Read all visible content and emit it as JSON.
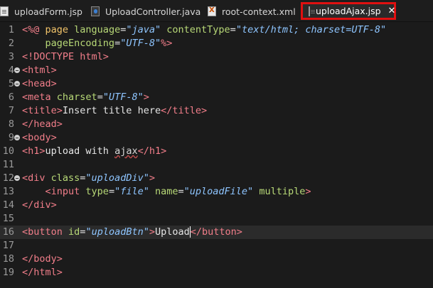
{
  "tabs": [
    {
      "label": "uploadForm.jsp",
      "icon": "document-icon",
      "active": false
    },
    {
      "label": "UploadController.java",
      "icon": "java-file-icon",
      "active": false
    },
    {
      "label": "root-context.xml",
      "icon": "xml-file-icon",
      "active": false
    },
    {
      "label": "uploadAjax.jsp",
      "icon": "document-icon",
      "active": true,
      "close": "✕"
    }
  ],
  "editor": {
    "lines": [
      {
        "num": "1",
        "fold": false,
        "tokens": [
          [
            "tg",
            "<%@ "
          ],
          [
            "kw",
            "page"
          ],
          [
            "tx",
            " "
          ],
          [
            "at",
            "language"
          ],
          [
            "tx",
            "="
          ],
          [
            "av",
            "\"java\""
          ],
          [
            "tx",
            " "
          ],
          [
            "at",
            "contentType"
          ],
          [
            "tx",
            "="
          ],
          [
            "av",
            "\"text/html; charset=UTF-8\""
          ]
        ]
      },
      {
        "num": "2",
        "fold": false,
        "tokens": [
          [
            "tx",
            "    "
          ],
          [
            "at",
            "pageEncoding"
          ],
          [
            "tx",
            "="
          ],
          [
            "av",
            "\"UTF-8\""
          ],
          [
            "tg",
            "%>"
          ]
        ]
      },
      {
        "num": "3",
        "fold": false,
        "tokens": [
          [
            "tg",
            "<!DOCTYPE html>"
          ]
        ]
      },
      {
        "num": "4",
        "fold": true,
        "tokens": [
          [
            "tg",
            "<html>"
          ]
        ]
      },
      {
        "num": "5",
        "fold": true,
        "tokens": [
          [
            "tg",
            "<head>"
          ]
        ]
      },
      {
        "num": "6",
        "fold": false,
        "tokens": [
          [
            "tg",
            "<meta "
          ],
          [
            "at",
            "charset"
          ],
          [
            "tx",
            "="
          ],
          [
            "av",
            "\"UTF-8\""
          ],
          [
            "tg",
            ">"
          ]
        ]
      },
      {
        "num": "7",
        "fold": false,
        "tokens": [
          [
            "tg",
            "<title>"
          ],
          [
            "tx",
            "Insert title here"
          ],
          [
            "tg",
            "</title>"
          ]
        ]
      },
      {
        "num": "8",
        "fold": false,
        "tokens": [
          [
            "tg",
            "</head>"
          ]
        ]
      },
      {
        "num": "9",
        "fold": true,
        "tokens": [
          [
            "tg",
            "<body>"
          ]
        ]
      },
      {
        "num": "10",
        "fold": false,
        "tokens": [
          [
            "tg",
            "<h1>"
          ],
          [
            "tx",
            "upload with "
          ],
          [
            "squig",
            "ajax"
          ],
          [
            "tg",
            "</h1>"
          ]
        ]
      },
      {
        "num": "11",
        "fold": false,
        "tokens": []
      },
      {
        "num": "12",
        "fold": true,
        "tokens": [
          [
            "tg",
            "<div "
          ],
          [
            "at",
            "class"
          ],
          [
            "tx",
            "="
          ],
          [
            "av",
            "\"uploadDiv\""
          ],
          [
            "tg",
            ">"
          ]
        ]
      },
      {
        "num": "13",
        "fold": false,
        "tokens": [
          [
            "tx",
            "    "
          ],
          [
            "tg",
            "<input "
          ],
          [
            "at",
            "type"
          ],
          [
            "tx",
            "="
          ],
          [
            "av",
            "\"file\""
          ],
          [
            "tx",
            " "
          ],
          [
            "at",
            "name"
          ],
          [
            "tx",
            "="
          ],
          [
            "av",
            "\"uploadFile\""
          ],
          [
            "tx",
            " "
          ],
          [
            "at",
            "multiple"
          ],
          [
            "tg",
            ">"
          ]
        ]
      },
      {
        "num": "14",
        "fold": false,
        "tokens": [
          [
            "tg",
            "</div>"
          ]
        ]
      },
      {
        "num": "15",
        "fold": false,
        "tokens": []
      },
      {
        "num": "16",
        "fold": false,
        "current": true,
        "tokens": [
          [
            "tg",
            "<button "
          ],
          [
            "at",
            "id"
          ],
          [
            "tx",
            "="
          ],
          [
            "av",
            "\"uploadBtn\""
          ],
          [
            "tg",
            ">"
          ],
          [
            "tx",
            "Upload"
          ],
          [
            "caret",
            ""
          ],
          [
            "tg",
            "</button>"
          ]
        ]
      },
      {
        "num": "17",
        "fold": false,
        "tokens": []
      },
      {
        "num": "18",
        "fold": false,
        "tokens": [
          [
            "tg",
            "</body>"
          ]
        ]
      },
      {
        "num": "19",
        "fold": false,
        "tokens": [
          [
            "tg",
            "</html>"
          ]
        ]
      }
    ]
  }
}
